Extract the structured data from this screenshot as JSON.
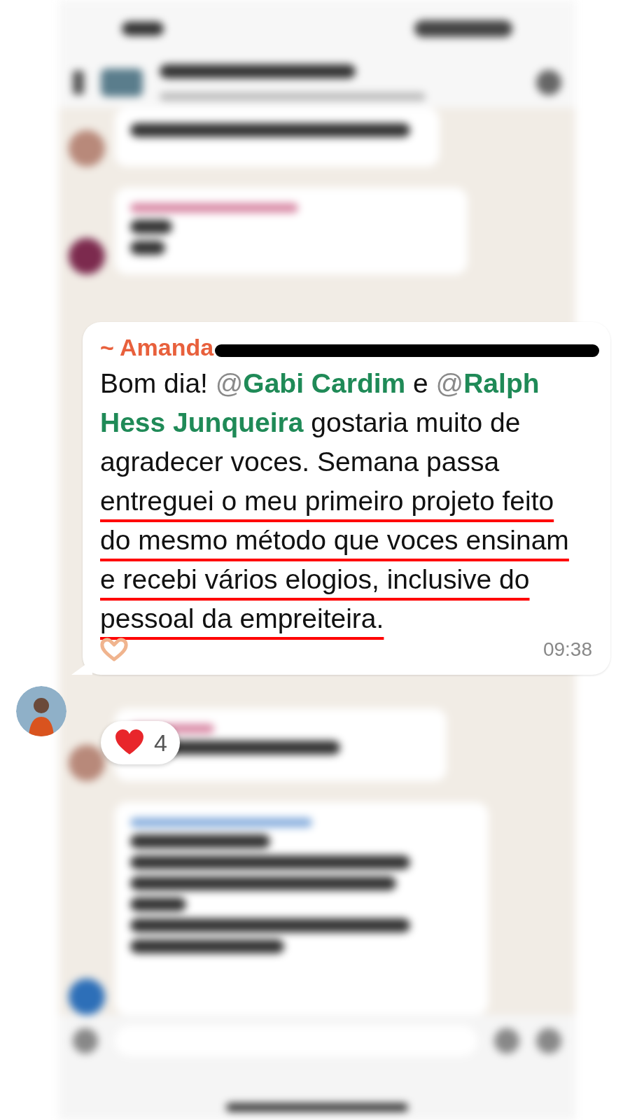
{
  "message": {
    "sender": "~ Amanda",
    "redacted": true,
    "segments": [
      {
        "kind": "text",
        "text": "Bom dia! "
      },
      {
        "kind": "mention",
        "at": "@",
        "name": "Gabi Cardim"
      },
      {
        "kind": "text",
        "text": " e "
      },
      {
        "kind": "mention",
        "at": "@",
        "name": "Ralph Hess Junqueira"
      },
      {
        "kind": "text",
        "text": " gostaria muito de agradecer voces. Semana passa "
      },
      {
        "kind": "highlight",
        "text": "entreguei o meu primeiro projeto feito do mesmo método que voces ensinam e recebi vários elogios, inclusive do pessoal da empreiteira."
      }
    ],
    "time": "09:38",
    "reaction": {
      "count": "4"
    }
  }
}
